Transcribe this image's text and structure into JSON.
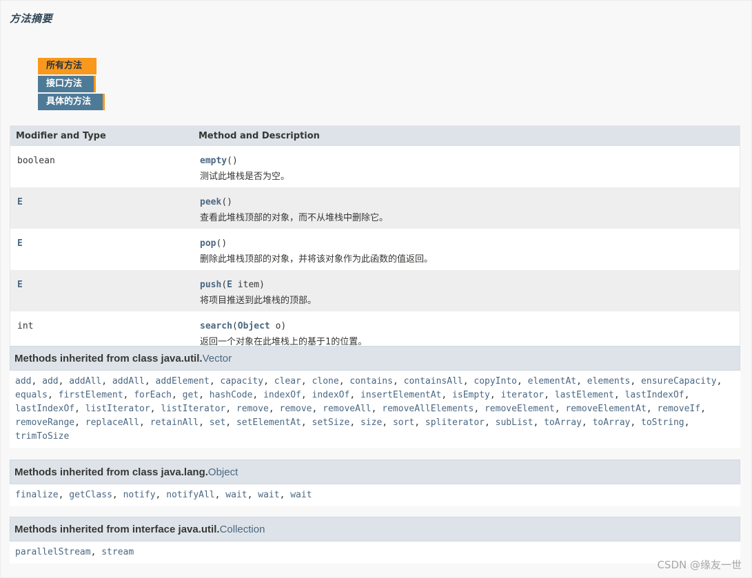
{
  "section_title": "方法摘要",
  "tabs": [
    {
      "label": "所有方法",
      "active": true
    },
    {
      "label": "接口方法",
      "active": false
    },
    {
      "label": "具体的方法",
      "active": false
    }
  ],
  "table": {
    "headers": [
      "Modifier and Type",
      "Method and Description"
    ],
    "rows": [
      {
        "type": "boolean",
        "type_is_link": false,
        "name": "empty",
        "params_open": "(",
        "param_type": "",
        "param_rest": ")",
        "desc": "测试此堆栈是否为空。"
      },
      {
        "type": "E",
        "type_is_link": true,
        "name": "peek",
        "params_open": "(",
        "param_type": "",
        "param_rest": ")",
        "desc": "查看此堆栈顶部的对象，而不从堆栈中删除它。"
      },
      {
        "type": "E",
        "type_is_link": true,
        "name": "pop",
        "params_open": "(",
        "param_type": "",
        "param_rest": ")",
        "desc": "删除此堆栈顶部的对象，并将该对象作为此函数的值返回。"
      },
      {
        "type": "E",
        "type_is_link": true,
        "name": "push",
        "params_open": "(",
        "param_type": "E",
        "param_rest": " item)",
        "desc": "将项目推送到此堆栈的顶部。"
      },
      {
        "type": "int",
        "type_is_link": false,
        "name": "search",
        "params_open": "(",
        "param_type": "Object",
        "param_rest": " o)",
        "desc": "返回一个对象在此堆栈上的基于1的位置。"
      }
    ]
  },
  "inherited": [
    {
      "prefix": "Methods inherited from class java.util.",
      "link": "Vector",
      "methods": [
        "add",
        "add",
        "addAll",
        "addAll",
        "addElement",
        "capacity",
        "clear",
        "clone",
        "contains",
        "containsAll",
        "copyInto",
        "elementAt",
        "elements",
        "ensureCapacity",
        "equals",
        "firstElement",
        "forEach",
        "get",
        "hashCode",
        "indexOf",
        "indexOf",
        "insertElementAt",
        "isEmpty",
        "iterator",
        "lastElement",
        "lastIndexOf",
        "lastIndexOf",
        "listIterator",
        "listIterator",
        "remove",
        "remove",
        "removeAll",
        "removeAllElements",
        "removeElement",
        "removeElementAt",
        "removeIf",
        "removeRange",
        "replaceAll",
        "retainAll",
        "set",
        "setElementAt",
        "setSize",
        "size",
        "sort",
        "spliterator",
        "subList",
        "toArray",
        "toArray",
        "toString",
        "trimToSize"
      ]
    },
    {
      "prefix": "Methods inherited from class java.lang.",
      "link": "Object",
      "methods": [
        "finalize",
        "getClass",
        "notify",
        "notifyAll",
        "wait",
        "wait",
        "wait"
      ]
    },
    {
      "prefix": "Methods inherited from interface java.util.",
      "link": "Collection",
      "methods": [
        "parallelStream",
        "stream"
      ]
    }
  ],
  "watermark": "CSDN @缘友一世",
  "colors": {
    "link": "#4a6782",
    "tab_active": "#f8981d",
    "tab_inactive": "#4d7a97",
    "header_bg": "#dee3e9"
  }
}
